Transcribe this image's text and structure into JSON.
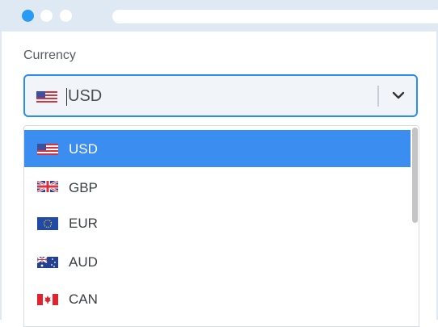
{
  "currency_field": {
    "label": "Currency",
    "value": "USD",
    "value_flag": "us-flag-icon"
  },
  "dropdown": {
    "options": [
      {
        "code": "USD",
        "flag": "us-flag-icon",
        "selected": true
      },
      {
        "code": "GBP",
        "flag": "uk-flag-icon",
        "selected": false
      },
      {
        "code": "EUR",
        "flag": "eu-flag-icon",
        "selected": false
      },
      {
        "code": "AUD",
        "flag": "au-flag-icon",
        "selected": false
      },
      {
        "code": "CAN",
        "flag": "ca-flag-icon",
        "selected": false
      }
    ]
  },
  "colors": {
    "accent": "#3b8ef0",
    "focus_border": "#2a8df2",
    "window_chrome": "#dfe9f3"
  }
}
